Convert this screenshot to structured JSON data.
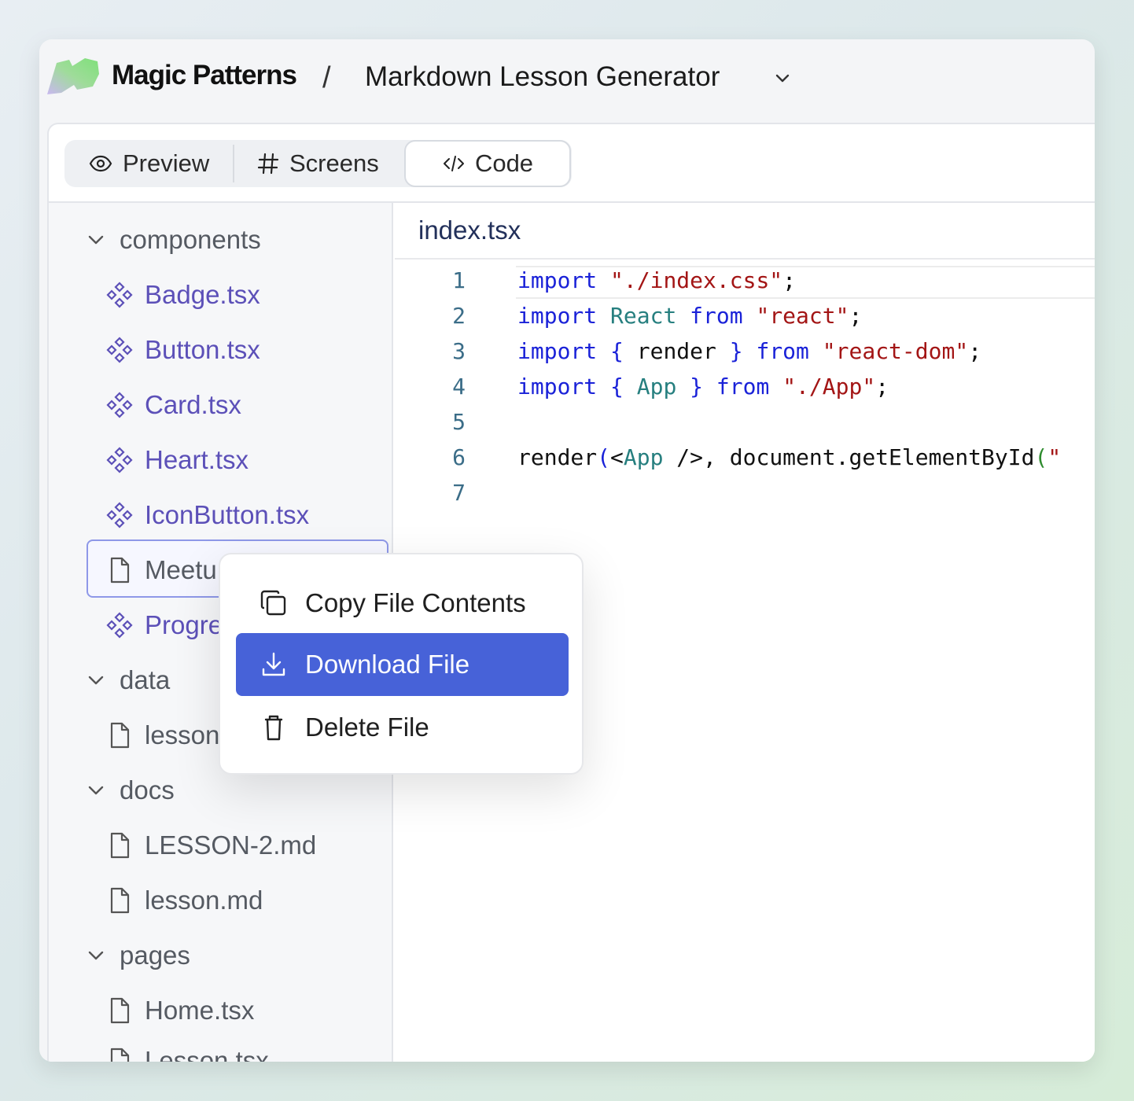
{
  "topbar": {
    "brand": "Magic Patterns",
    "separator": "/",
    "project_title": "Markdown Lesson Generator"
  },
  "tabs": [
    {
      "label": "Preview",
      "icon": "eye-icon"
    },
    {
      "label": "Screens",
      "icon": "hash-icon"
    },
    {
      "label": "Code",
      "icon": "code-icon",
      "active": true
    }
  ],
  "sidebar": {
    "folders": {
      "components": "components",
      "data": "data",
      "docs": "docs",
      "pages": "pages"
    },
    "files": {
      "badge": "Badge.tsx",
      "button": "Button.tsx",
      "card": "Card.tsx",
      "heart": "Heart.tsx",
      "iconbutton": "IconButton.tsx",
      "meetup": "Meetu",
      "progress": "Progre",
      "lesson_data": "lesson",
      "lesson2": "LESSON-2.md",
      "lesson_md": "lesson.md",
      "home": "Home.tsx",
      "lesson_tsx": "Lesson.tsx"
    }
  },
  "editor": {
    "filename": "index.tsx",
    "line_numbers": [
      "1",
      "2",
      "3",
      "4",
      "5",
      "6",
      "7"
    ],
    "tokens": {
      "import": "import",
      "from": "from",
      "react_ident": "React",
      "render": "render",
      "app": "App",
      "lbrace": "{",
      "rbrace": "}",
      "str_css": "\"./index.css\"",
      "str_react": "\"react\"",
      "str_dom": "\"react-dom\"",
      "str_app": "\"./App\"",
      "semi": ";",
      "line6_a": "render",
      "line6_paren": "(",
      "line6_lt": "<",
      "line6_app": "App",
      "line6_rest": " />, document.getElementById",
      "line6_paren2": "(",
      "line6_quote": "\""
    }
  },
  "context_menu": {
    "copy": "Copy File Contents",
    "download": "Download File",
    "delete": "Delete File"
  },
  "colors": {
    "accent": "#4762d8",
    "component_file": "#5c50b8",
    "keyword": "#1a22d8",
    "string": "#a31515"
  }
}
